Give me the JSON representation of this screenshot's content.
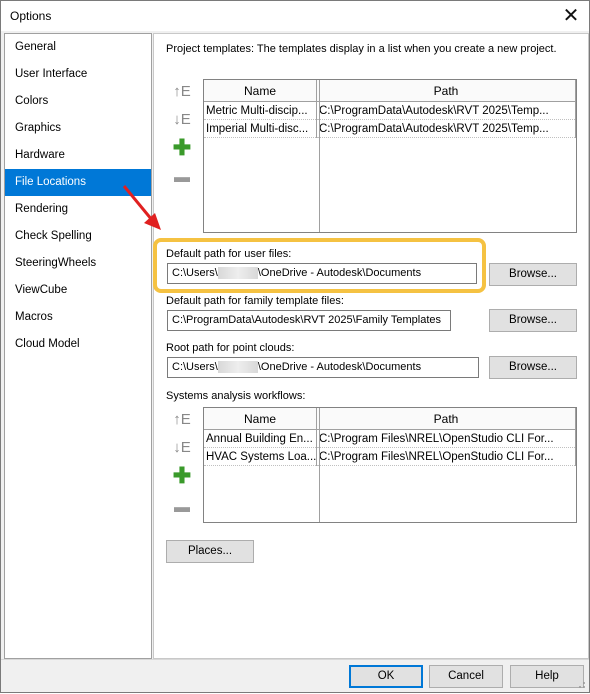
{
  "window": {
    "title": "Options"
  },
  "sidebar": {
    "items": [
      {
        "label": "General",
        "selected": false
      },
      {
        "label": "User Interface",
        "selected": false
      },
      {
        "label": "Colors",
        "selected": false
      },
      {
        "label": "Graphics",
        "selected": false
      },
      {
        "label": "Hardware",
        "selected": false
      },
      {
        "label": "File Locations",
        "selected": true
      },
      {
        "label": "Rendering",
        "selected": false
      },
      {
        "label": "Check Spelling",
        "selected": false
      },
      {
        "label": "SteeringWheels",
        "selected": false
      },
      {
        "label": "ViewCube",
        "selected": false
      },
      {
        "label": "Macros",
        "selected": false
      },
      {
        "label": "Cloud Model",
        "selected": false
      }
    ]
  },
  "project_templates": {
    "heading": "Project templates:  The templates display in a list when you create a new project.",
    "columns": [
      "Name",
      "Path"
    ],
    "rows": [
      {
        "name": "Metric Multi-discip...",
        "path": "C:\\ProgramData\\Autodesk\\RVT 2025\\Temp..."
      },
      {
        "name": "Imperial Multi-disc...",
        "path": "C:\\ProgramData\\Autodesk\\RVT 2025\\Temp..."
      }
    ]
  },
  "user_files": {
    "label": "Default path for user files:",
    "value_prefix": "C:\\Users\\",
    "value_suffix": "\\OneDrive - Autodesk\\Documents",
    "browse_label": "Browse..."
  },
  "family_templates": {
    "label": "Default path for family template files:",
    "value": "C:\\ProgramData\\Autodesk\\RVT 2025\\Family Templates",
    "browse_label": "Browse..."
  },
  "point_clouds": {
    "label": "Root path for point clouds:",
    "value_prefix": "C:\\Users\\",
    "value_suffix": "\\OneDrive - Autodesk\\Documents",
    "browse_label": "Browse..."
  },
  "systems_analysis": {
    "heading": "Systems analysis workflows:",
    "columns": [
      "Name",
      "Path"
    ],
    "rows": [
      {
        "name": "Annual Building En...",
        "path": "C:\\Program Files\\NREL\\OpenStudio CLI For..."
      },
      {
        "name": "HVAC Systems Loa...",
        "path": "C:\\Program Files\\NREL\\OpenStudio CLI For..."
      }
    ]
  },
  "places_label": "Places...",
  "footer": {
    "ok": "OK",
    "cancel": "Cancel",
    "help": "Help"
  },
  "colors": {
    "accent": "#0078d7",
    "highlight": "#f5c242",
    "annotation_arrow": "#e02020"
  }
}
